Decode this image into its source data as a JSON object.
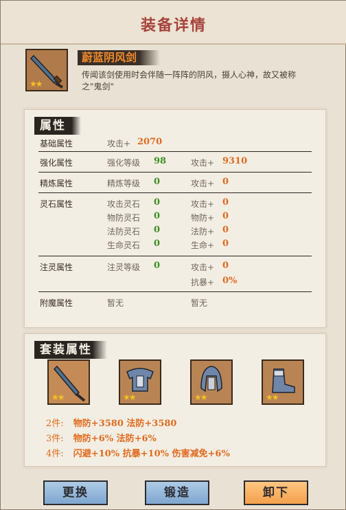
{
  "window": {
    "title": "装备详情"
  },
  "item": {
    "name": "蔚蓝阴风剑",
    "description": "传闻该剑使用时会伴随一阵阵的阴风，摄人心神，故又被称之\"鬼剑\"",
    "stars": "★★"
  },
  "attributes": {
    "section_title": "属性",
    "base": {
      "label": "基础属性",
      "key": "攻击+",
      "value": "2070"
    },
    "enhance": {
      "label": "强化属性",
      "level_key": "强化等级",
      "level": "98",
      "atk_key": "攻击+",
      "atk": "9310"
    },
    "refine": {
      "label": "精炼属性",
      "level_key": "精炼等级",
      "level": "0",
      "atk_key": "攻击+",
      "atk": "0"
    },
    "gem": {
      "label": "灵石属性",
      "rows": [
        {
          "k1": "攻击灵石",
          "v1": "0",
          "k2": "攻击+",
          "v2": "0"
        },
        {
          "k1": "物防灵石",
          "v1": "0",
          "k2": "物防+",
          "v2": "0"
        },
        {
          "k1": "法防灵石",
          "v1": "0",
          "k2": "法防+",
          "v2": "0"
        },
        {
          "k1": "生命灵石",
          "v1": "0",
          "k2": "生命+",
          "v2": "0"
        }
      ]
    },
    "spirit": {
      "label": "注灵属性",
      "level_key": "注灵等级",
      "level": "0",
      "atk_key": "攻击+",
      "atk": "0",
      "crit_key": "抗暴+",
      "crit": "0%"
    },
    "enchant": {
      "label": "附魔属性",
      "v1": "暂无",
      "v2": "暂无"
    }
  },
  "set": {
    "section_title": "套装属性",
    "pieces": [
      {
        "icon": "sword-icon",
        "stars": "★★"
      },
      {
        "icon": "armor-icon",
        "stars": "★★"
      },
      {
        "icon": "helmet-icon",
        "stars": "★★"
      },
      {
        "icon": "boots-icon",
        "stars": "★★"
      }
    ],
    "bonuses": [
      {
        "count": "2件:",
        "text": "物防+3580  法防+3580"
      },
      {
        "count": "3件:",
        "text": "物防+6%  法防+6%"
      },
      {
        "count": "4件:",
        "text": "闪避+10%  抗暴+10%  伤害减免+6%"
      }
    ]
  },
  "buttons": {
    "replace": "更换",
    "forge": "锻造",
    "unequip": "卸下"
  },
  "colors": {
    "title": "#a6433a",
    "accent_orange": "#e06a1d",
    "accent_green": "#3d8f24",
    "button_blue": "#8fb3d8",
    "button_orange": "#f4a04b"
  }
}
